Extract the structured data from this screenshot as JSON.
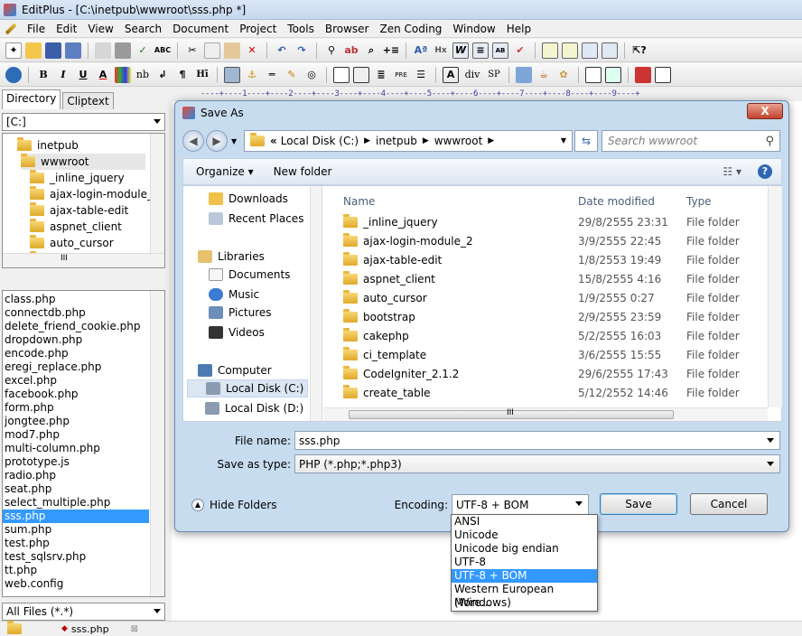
{
  "app": {
    "title": "EditPlus - [C:\\inetpub\\wwwroot\\sss.php *]"
  },
  "menu": [
    "File",
    "Edit",
    "View",
    "Search",
    "Document",
    "Project",
    "Tools",
    "Browser",
    "Zen Coding",
    "Window",
    "Help"
  ],
  "toolbar2_text": {
    "hx": "Hx",
    "nb": "nb",
    "pre": "PRE",
    "div": "div",
    "sp": "SP"
  },
  "left": {
    "tabs": [
      "Directory",
      "Cliptext"
    ],
    "drive": "[C:]",
    "tree": [
      "inetpub",
      "wwwroot",
      "_inline_jquery",
      "ajax-login-module_2",
      "ajax-table-edit",
      "aspnet_client",
      "auto_cursor",
      "bootstrap"
    ],
    "tree_scroll_label": "III",
    "files": [
      "class.php",
      "connectdb.php",
      "delete_friend_cookie.php",
      "dropdown.php",
      "encode.php",
      "eregi_replace.php",
      "excel.php",
      "facebook.php",
      "form.php",
      "jongtee.php",
      "mod7.php",
      "multi-column.php",
      "prototype.js",
      "radio.php",
      "seat.php",
      "select_multiple.php",
      "sss.php",
      "sum.php",
      "test.php",
      "test_sqlsrv.php",
      "tt.php",
      "web.config"
    ],
    "selected_file": "sss.php",
    "filter": "All Files (*.*)"
  },
  "ruler": "----+----1----+----2----+----3----+----4----+----5----+----6----+----7----+----8----+----9----+",
  "doc_tab": "sss.php",
  "dialog": {
    "title": "Save As",
    "close": "X",
    "address": [
      "«",
      "Local Disk (C:)",
      "inetpub",
      "wwwroot"
    ],
    "search_placeholder": "Search wwwroot",
    "organize": "Organize ▾",
    "new_folder": "New folder",
    "nav": [
      "Downloads",
      "Recent Places",
      "Libraries",
      "Documents",
      "Music",
      "Pictures",
      "Videos",
      "Computer",
      "Local Disk (C:)",
      "Local Disk (D:)"
    ],
    "columns": {
      "name": "Name",
      "date": "Date modified",
      "type": "Type"
    },
    "files": [
      {
        "name": "_inline_jquery",
        "date": "29/8/2555 23:31",
        "type": "File folder"
      },
      {
        "name": "ajax-login-module_2",
        "date": "3/9/2555 22:45",
        "type": "File folder"
      },
      {
        "name": "ajax-table-edit",
        "date": "1/8/2553 19:49",
        "type": "File folder"
      },
      {
        "name": "aspnet_client",
        "date": "15/8/2555 4:16",
        "type": "File folder"
      },
      {
        "name": "auto_cursor",
        "date": "1/9/2555 0:27",
        "type": "File folder"
      },
      {
        "name": "bootstrap",
        "date": "2/9/2555 23:59",
        "type": "File folder"
      },
      {
        "name": "cakephp",
        "date": "5/2/2555 16:03",
        "type": "File folder"
      },
      {
        "name": "ci_template",
        "date": "3/6/2555 15:55",
        "type": "File folder"
      },
      {
        "name": "CodeIgniter_2.1.2",
        "date": "29/6/2555 17:43",
        "type": "File folder"
      },
      {
        "name": "create_table",
        "date": "5/12/2552 14:46",
        "type": "File folder"
      }
    ],
    "hscroll_label": "III",
    "file_name_label": "File name:",
    "file_name": "sss.php",
    "save_type_label": "Save as type:",
    "save_type": "PHP (*.php;*.php3)",
    "hide_folders": "Hide Folders",
    "encoding_label": "Encoding:",
    "encoding": "UTF-8 + BOM",
    "save": "Save",
    "cancel": "Cancel"
  },
  "encoding_options": [
    "ANSI",
    "Unicode",
    "Unicode big endian",
    "UTF-8",
    "UTF-8 + BOM",
    "Western European (Windows)",
    "More..."
  ],
  "encoding_selected_index": 4
}
